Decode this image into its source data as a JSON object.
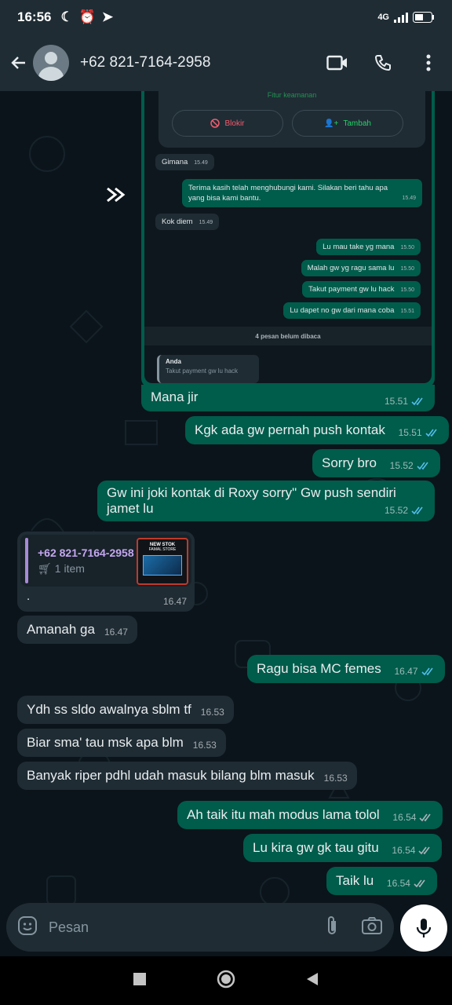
{
  "status": {
    "time": "16:56",
    "network": "4G"
  },
  "header": {
    "contact": "+62 821-7164-2958"
  },
  "screenshot": {
    "block_label": "Blokir",
    "add_label": "Tambah",
    "top_cut": "Fitur keamanan",
    "messages": [
      {
        "text": "Gimana",
        "time": "15.49",
        "dir": "in"
      },
      {
        "text": "Terima kasih telah menghubungi kami. Silakan beri tahu apa",
        "text2": "yang bisa kami bantu.",
        "time": "15.49",
        "dir": "out"
      },
      {
        "text": "Kok diem",
        "time": "15.49",
        "dir": "in"
      },
      {
        "text": "Lu mau take yg mana",
        "time": "15.50",
        "dir": "out"
      },
      {
        "text": "Malah gw yg ragu sama lu",
        "time": "15.50",
        "dir": "out"
      },
      {
        "text": "Takut payment gw lu hack",
        "time": "15.50",
        "dir": "out"
      },
      {
        "text": "Lu dapet no gw dari mana coba",
        "time": "15.51",
        "dir": "out"
      }
    ],
    "unread": "4 pesan belum dibaca",
    "reply_name": "Anda",
    "reply_text": "Takut payment gw lu hack"
  },
  "caption": {
    "text": "Mana jir",
    "time": "15.51"
  },
  "messages": [
    {
      "text": "Kgk ada gw pernah push kontak",
      "time": "15.51"
    },
    {
      "text": "Sorry bro",
      "time": "15.52"
    },
    {
      "text": "Gw ini joki kontak di Roxy sorry\" Gw push sendiri jamet lu",
      "time": "15.52"
    },
    {
      "text": "Amanah ga",
      "time": "16.47"
    },
    {
      "text": "Ragu bisa MC femes",
      "time": "16.47"
    },
    {
      "text": "Ydh ss sldo awalnya sblm tf",
      "time": "16.53"
    },
    {
      "text": "Biar sma' tau msk apa blm",
      "time": "16.53"
    },
    {
      "text": "Banyak riper pdhl udah masuk bilang blm masuk",
      "time": "16.53"
    },
    {
      "text": "Ah taik itu mah modus lama tolol",
      "time": "16.54"
    },
    {
      "text": "Lu kira gw gk tau gitu",
      "time": "16.54"
    },
    {
      "text": "Taik lu",
      "time": "16.54"
    }
  ],
  "product": {
    "phone": "+62 821-7164-2958",
    "items": "1 item",
    "caption": ".",
    "time": "16.47",
    "thumb_title": "NEW STOK",
    "thumb_sub": "FAMAL STORE"
  },
  "input": {
    "placeholder": "Pesan"
  },
  "colors": {
    "out_bubble": "#005c4b",
    "in_bubble": "#1f2c34",
    "tick": "#53bdeb",
    "product_bar": "#a78bd6"
  }
}
